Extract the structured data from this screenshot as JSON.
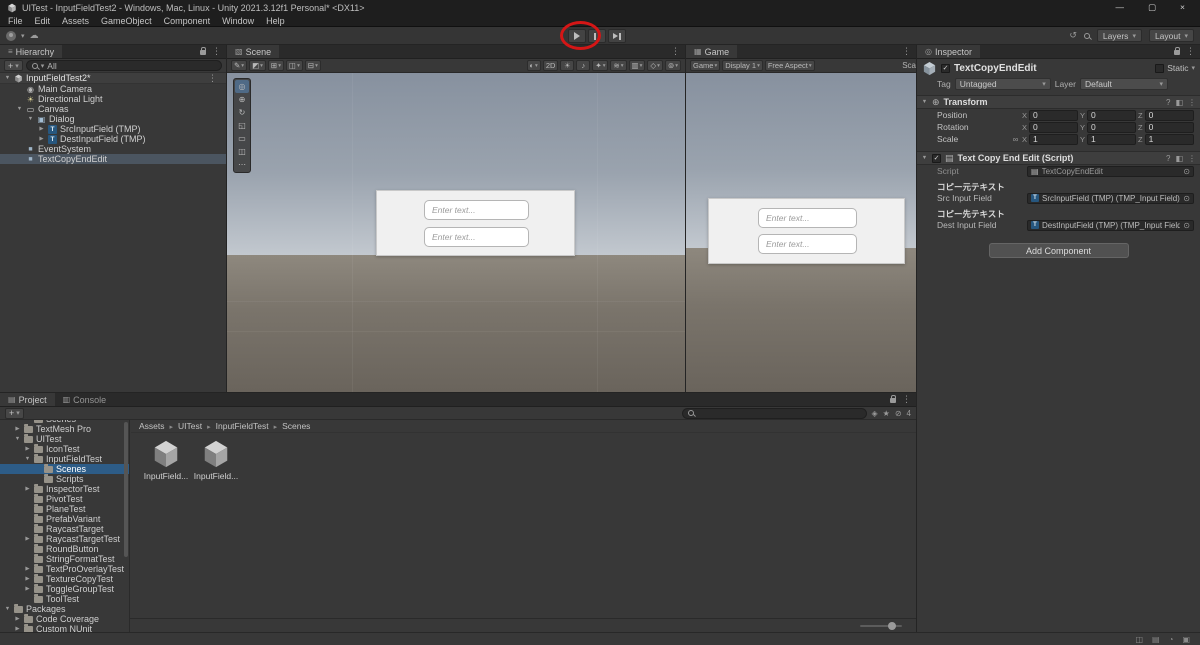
{
  "window": {
    "title": "UITest - InputFieldTest2 - Windows, Mac, Linux - Unity 2021.3.12f1 Personal* <DX11>",
    "menus": [
      "File",
      "Edit",
      "Assets",
      "GameObject",
      "Component",
      "Window",
      "Help"
    ]
  },
  "icons": {
    "minimize": "—",
    "maximize": "▢",
    "close": "×",
    "menu": "⋮",
    "caret": "▾",
    "picker": "⊙",
    "help": "?",
    "preset": "◧",
    "link": "∞",
    "plus": "+",
    "history": "↺",
    "cloud": "☁",
    "hidden": "⊘",
    "star": "★",
    "filter": "◈",
    "script": "▤",
    "tmp": "T",
    "tab_hierarchy": "≡",
    "tab_scene": "▧",
    "tab_game": "▦",
    "tab_inspector": "◎",
    "tab_project": "▤",
    "tab_console": "▥"
  },
  "toolbar": {
    "layers_label": "Layers",
    "layout_label": "Layout"
  },
  "hierarchy": {
    "tab": "Hierarchy",
    "search_value": "All",
    "scene_name": "InputFieldTest2*",
    "items": [
      {
        "label": "Main Camera",
        "icon": "camera",
        "depth": 1,
        "arrow": ""
      },
      {
        "label": "Directional Light",
        "icon": "light",
        "depth": 1,
        "arrow": ""
      },
      {
        "label": "Canvas",
        "icon": "canvas",
        "depth": 1,
        "arrow": "down"
      },
      {
        "label": "Dialog",
        "icon": "rect",
        "depth": 2,
        "arrow": "down"
      },
      {
        "label": "SrcInputField (TMP)",
        "icon": "input",
        "depth": 3,
        "arrow": "right"
      },
      {
        "label": "DestInputField (TMP)",
        "icon": "input",
        "depth": 3,
        "arrow": "right"
      },
      {
        "label": "EventSystem",
        "icon": "gameobject",
        "depth": 1,
        "arrow": ""
      },
      {
        "label": "TextCopyEndEdit",
        "icon": "gameobject",
        "depth": 1,
        "arrow": "",
        "selected": true
      }
    ]
  },
  "scene": {
    "tab": "Scene",
    "toolbar_left": [
      {
        "name": "tool-settings-icon",
        "glyph": "✎",
        "caret": true
      },
      {
        "name": "pivot-toggle-icon",
        "glyph": "◩",
        "caret": true
      },
      {
        "name": "grid-snap-icon",
        "glyph": "⊞",
        "caret": true
      },
      {
        "name": "snap-move-icon",
        "glyph": "◫",
        "caret": true
      },
      {
        "name": "snap-settings-icon",
        "glyph": "⊟",
        "caret": true
      }
    ],
    "toolbar_right": [
      {
        "name": "shading-mode-icon",
        "glyph": "◐",
        "caret": true
      },
      {
        "name": "2d-toggle-button",
        "glyph": "2D"
      },
      {
        "name": "lighting-toggle-icon",
        "glyph": "☀"
      },
      {
        "name": "audio-toggle-icon",
        "glyph": "♪"
      },
      {
        "name": "effects-toggle-icon",
        "glyph": "✦",
        "caret": true
      },
      {
        "name": "hidden-objects-icon",
        "glyph": "≋",
        "caret": true
      },
      {
        "name": "grid-visibility-icon",
        "glyph": "▥",
        "caret": true
      },
      {
        "name": "camera-overlay-icon",
        "glyph": "◇",
        "caret": true
      },
      {
        "name": "gizmos-menu-button",
        "glyph": "⊚",
        "caret": true
      }
    ],
    "tools": [
      {
        "name": "view-tool",
        "glyph": "◎",
        "active": true
      },
      {
        "name": "move-tool",
        "glyph": "⊕"
      },
      {
        "name": "rotate-tool",
        "glyph": "↻"
      },
      {
        "name": "scale-tool",
        "glyph": "◱"
      },
      {
        "name": "rect-tool",
        "glyph": "▭"
      },
      {
        "name": "transform-tool",
        "glyph": "◫"
      },
      {
        "name": "custom-tools",
        "glyph": "⋯"
      }
    ],
    "input_placeholder": "Enter text..."
  },
  "game": {
    "tab": "Game",
    "mode_label": "Game",
    "display_label": "Display 1",
    "aspect_label": "Free Aspect",
    "scale_label": "Sca",
    "input_placeholder": "Enter text..."
  },
  "inspector": {
    "tab": "Inspector",
    "object_name": "TextCopyEndEdit",
    "static_label": "Static",
    "tag_label": "Tag",
    "tag_value": "Untagged",
    "layer_label": "Layer",
    "layer_value": "Default",
    "axes": [
      "X",
      "Y",
      "Z"
    ],
    "transform": {
      "title": "Transform",
      "rows": [
        {
          "label": "Position",
          "x": "0",
          "y": "0",
          "z": "0"
        },
        {
          "label": "Rotation",
          "x": "0",
          "y": "0",
          "z": "0"
        },
        {
          "label": "Scale",
          "x": "1",
          "y": "1",
          "z": "1",
          "link": true
        }
      ]
    },
    "script": {
      "title": "Text Copy End Edit (Script)",
      "script_label": "Script",
      "script_value": "TextCopyEndEdit",
      "src_header": "コピー元テキスト",
      "src_label": "Src Input Field",
      "src_value": "SrcInputField (TMP) (TMP_Input Field)",
      "dest_header": "コピー先テキスト",
      "dest_label": "Dest Input Field",
      "dest_value": "DestInputField (TMP) (TMP_Input Field)"
    },
    "add_component_label": "Add Component"
  },
  "project": {
    "tab_project": "Project",
    "tab_console": "Console",
    "search_value": "",
    "hidden_count": "4",
    "tree": [
      {
        "label": "Scenes",
        "depth": 2,
        "arrow": "",
        "clipped": true
      },
      {
        "label": "TextMesh Pro",
        "depth": 1,
        "arrow": "right"
      },
      {
        "label": "UITest",
        "depth": 1,
        "arrow": "down"
      },
      {
        "label": "IconTest",
        "depth": 2,
        "arrow": "right"
      },
      {
        "label": "InputFieldTest",
        "depth": 2,
        "arrow": "down"
      },
      {
        "label": "Scenes",
        "depth": 3,
        "arrow": "",
        "selected": true
      },
      {
        "label": "Scripts",
        "depth": 3,
        "arrow": ""
      },
      {
        "label": "InspectorTest",
        "depth": 2,
        "arrow": "right"
      },
      {
        "label": "PivotTest",
        "depth": 2,
        "arrow": ""
      },
      {
        "label": "PlaneTest",
        "depth": 2,
        "arrow": ""
      },
      {
        "label": "PrefabVariant",
        "depth": 2,
        "arrow": ""
      },
      {
        "label": "RaycastTarget",
        "depth": 2,
        "arrow": ""
      },
      {
        "label": "RaycastTargetTest",
        "depth": 2,
        "arrow": "right"
      },
      {
        "label": "RoundButton",
        "depth": 2,
        "arrow": ""
      },
      {
        "label": "StringFormatTest",
        "depth": 2,
        "arrow": ""
      },
      {
        "label": "TextProOverlayTest",
        "depth": 2,
        "arrow": "right"
      },
      {
        "label": "TextureCopyTest",
        "depth": 2,
        "arrow": "right"
      },
      {
        "label": "ToggleGroupTest",
        "depth": 2,
        "arrow": "right"
      },
      {
        "label": "ToolTest",
        "depth": 2,
        "arrow": ""
      },
      {
        "label": "Packages",
        "depth": 0,
        "arrow": "down"
      },
      {
        "label": "Code Coverage",
        "depth": 1,
        "arrow": "right"
      },
      {
        "label": "Custom NUnit",
        "depth": 1,
        "arrow": "right"
      }
    ],
    "breadcrumb": [
      "Assets",
      "UITest",
      "InputFieldTest",
      "Scenes"
    ],
    "files": [
      {
        "label": "InputField..."
      },
      {
        "label": "InputField..."
      }
    ]
  },
  "status": {
    "icons": [
      {
        "name": "cache-server-icon",
        "glyph": "◫"
      },
      {
        "name": "code-coverage-icon",
        "glyph": "▤"
      },
      {
        "name": "activity-icon",
        "glyph": "◔"
      },
      {
        "name": "console-status-icon",
        "glyph": "▣"
      }
    ]
  }
}
